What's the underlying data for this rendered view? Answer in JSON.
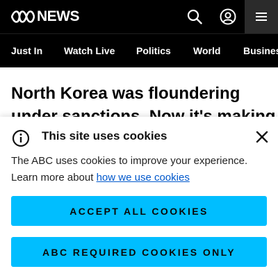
{
  "header": {
    "logo_text": "NEWS",
    "icons": [
      "abc-logo-icon",
      "search-icon",
      "account-icon",
      "menu-icon"
    ]
  },
  "nav": {
    "items": [
      "Just In",
      "Watch Live",
      "Politics",
      "World",
      "Business"
    ]
  },
  "article": {
    "headline_line1": "North Korea was floundering",
    "headline_line2": "under sanctions. Now it's making"
  },
  "cookie_banner": {
    "title": "This site uses cookies",
    "body_text": "The ABC uses cookies to improve your experience. Learn more about ",
    "link_text": "how we use cookies",
    "accept_all_label": "ACCEPT ALL COOKIES",
    "required_only_label": "ABC REQUIRED COOKIES ONLY"
  },
  "colors": {
    "header_bg": "#000000",
    "menu_button_bg": "#2b2b2b",
    "accent_button": "#00beff",
    "link": "#0058cc"
  }
}
